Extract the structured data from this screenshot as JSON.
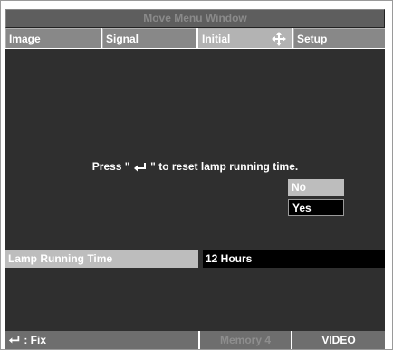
{
  "window": {
    "title": "Move Menu Window"
  },
  "tabs": [
    {
      "label": "Image",
      "active": false
    },
    {
      "label": "Signal",
      "active": false
    },
    {
      "label": "Initial",
      "active": true,
      "icon": "move-arrows-icon"
    },
    {
      "label": "Setup",
      "active": false
    }
  ],
  "content": {
    "message_prefix": "Press \"",
    "message_icon": "enter-icon",
    "message_suffix": "\" to reset lamp running time.",
    "options": {
      "no": "No",
      "yes": "Yes",
      "selected": "no"
    },
    "lamp": {
      "label": "Lamp Running Time",
      "value": "12 Hours"
    }
  },
  "status": {
    "fix_icon": "enter-icon",
    "fix_label": ": Fix",
    "memory": "Memory 4",
    "source": "VIDEO"
  },
  "colors": {
    "panel": "#2f2f2f",
    "tab": "#888888",
    "tab_active": "#b3b3b3",
    "highlight": "#bdbdbd",
    "value_bg": "#000000"
  }
}
